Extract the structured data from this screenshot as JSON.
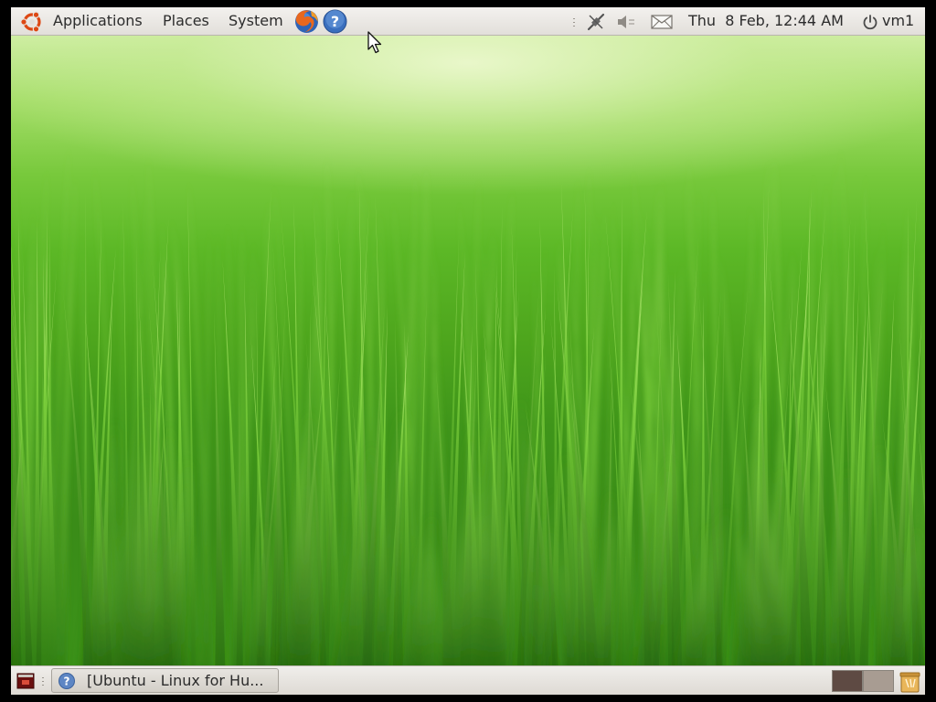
{
  "top_panel": {
    "menus": {
      "applications": "Applications",
      "places": "Places",
      "system": "System"
    },
    "launchers": {
      "firefox_icon": "firefox-icon",
      "help_icon": "help-icon"
    },
    "clock": "Thu  8 Feb, 12:44 AM",
    "user": "vm1"
  },
  "bottom_panel": {
    "show_desktop_icon": "show-desktop-icon",
    "taskbar_window_title": "[Ubuntu - Linux for Hu...",
    "workspaces": [
      "workspace-1",
      "workspace-2"
    ],
    "trash_icon": "trash-icon"
  },
  "colors": {
    "panel": "#ebe8e4",
    "ubuntu_orange": "#dd4814",
    "wallpaper_green": "#4ea61d"
  }
}
